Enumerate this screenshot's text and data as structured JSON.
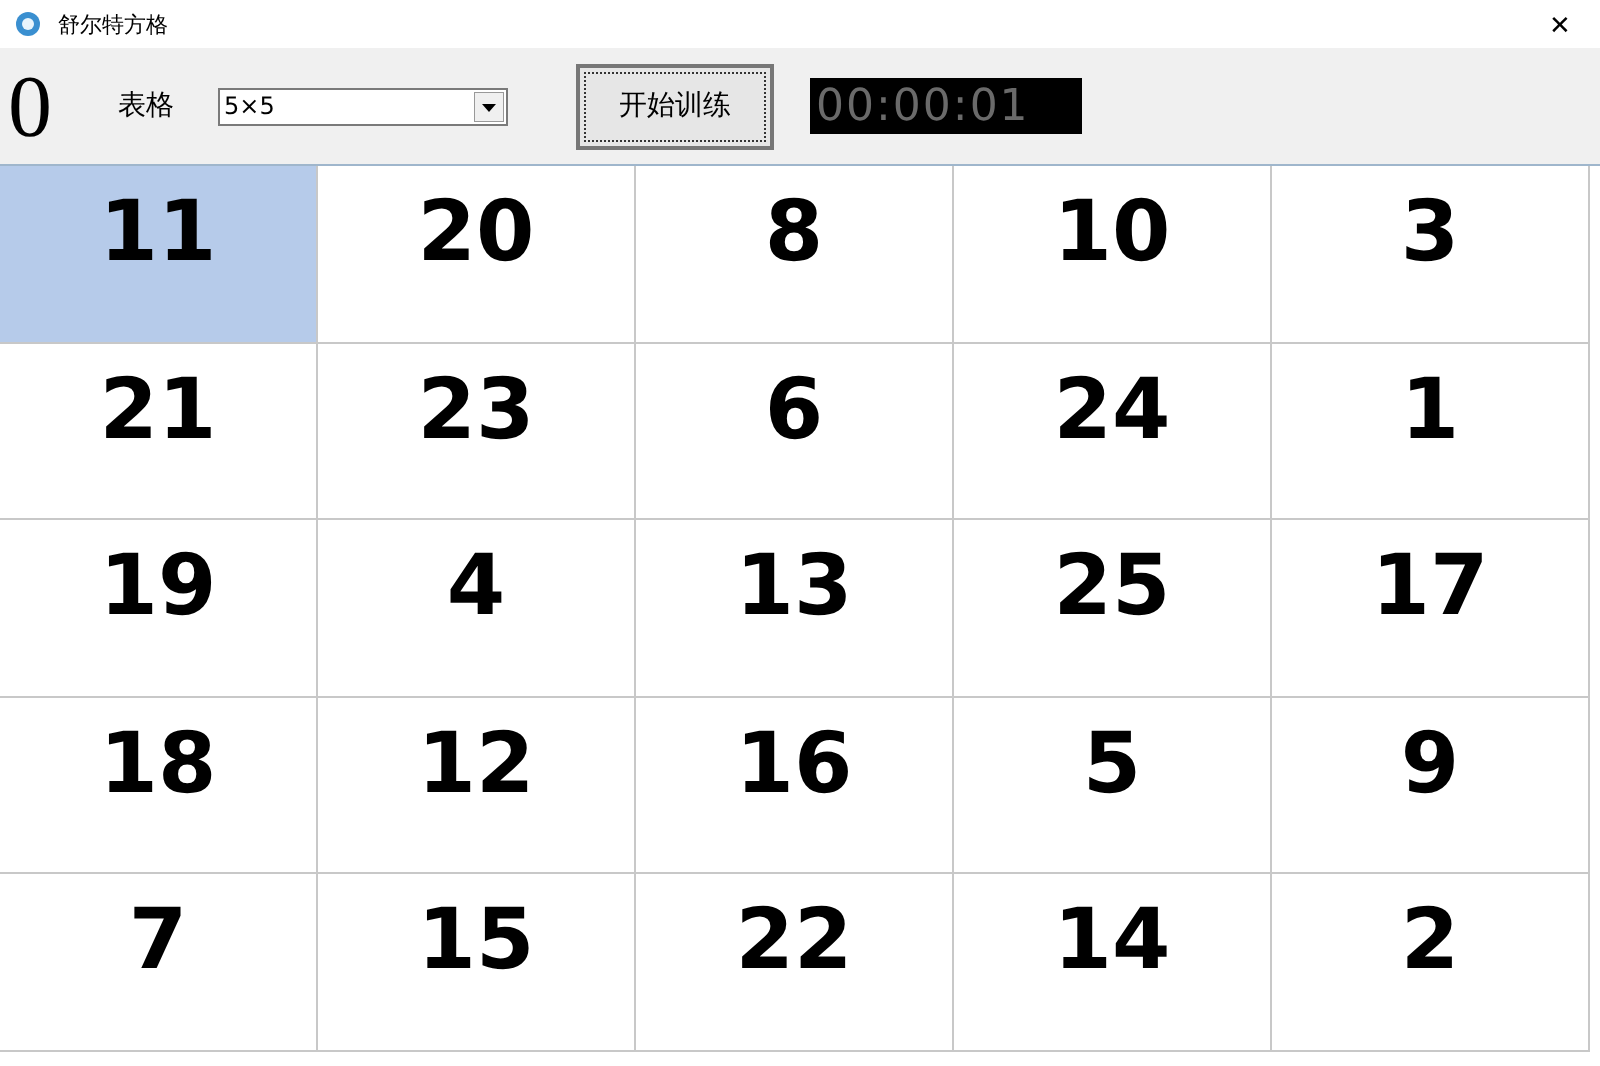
{
  "window": {
    "title": "舒尔特方格",
    "close": "✕"
  },
  "toolbar": {
    "count": "0",
    "grid_label": "表格",
    "grid_size": "5×5",
    "start_button": "开始训练",
    "timer": "00:00:01"
  },
  "cells": [
    {
      "value": "11",
      "selected": true
    },
    {
      "value": "20",
      "selected": false
    },
    {
      "value": "8",
      "selected": false
    },
    {
      "value": "10",
      "selected": false
    },
    {
      "value": "3",
      "selected": false
    },
    {
      "value": "21",
      "selected": false
    },
    {
      "value": "23",
      "selected": false
    },
    {
      "value": "6",
      "selected": false
    },
    {
      "value": "24",
      "selected": false
    },
    {
      "value": "1",
      "selected": false
    },
    {
      "value": "19",
      "selected": false
    },
    {
      "value": "4",
      "selected": false
    },
    {
      "value": "13",
      "selected": false
    },
    {
      "value": "25",
      "selected": false
    },
    {
      "value": "17",
      "selected": false
    },
    {
      "value": "18",
      "selected": false
    },
    {
      "value": "12",
      "selected": false
    },
    {
      "value": "16",
      "selected": false
    },
    {
      "value": "5",
      "selected": false
    },
    {
      "value": "9",
      "selected": false
    },
    {
      "value": "7",
      "selected": false
    },
    {
      "value": "15",
      "selected": false
    },
    {
      "value": "22",
      "selected": false
    },
    {
      "value": "14",
      "selected": false
    },
    {
      "value": "2",
      "selected": false
    }
  ]
}
